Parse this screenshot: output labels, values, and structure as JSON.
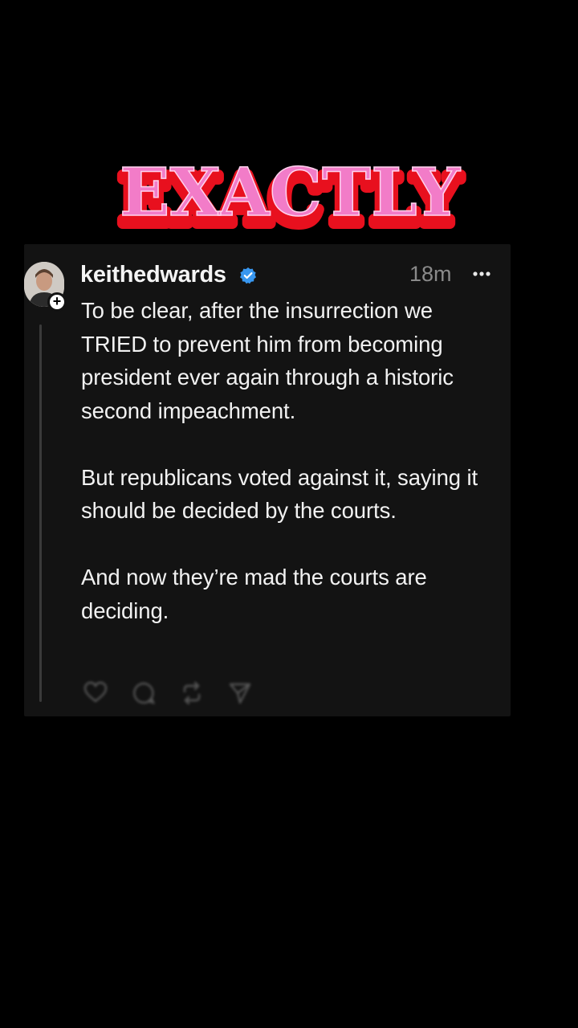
{
  "overlay": {
    "sticker_text": "EXACTLY"
  },
  "post": {
    "username": "keithedwards",
    "timestamp": "18m",
    "paragraphs": [
      "To be clear, after the insurrection we TRIED to prevent him from becoming president ever again through a historic second impeachment.",
      "But republicans voted against it, saying it should be decided by the courts.",
      "And now they’re mad the courts are deciding."
    ],
    "icons": {
      "verified": "verified-badge-icon",
      "more": "more-options-icon",
      "follow": "follow-plus-icon",
      "like": "heart-icon",
      "reply": "comment-icon",
      "repost": "repost-icon",
      "share": "send-icon"
    }
  },
  "colors": {
    "background": "#000000",
    "card": "#131313",
    "text": "#f2f2f2",
    "muted": "#8a8a8a",
    "verified": "#3897f0",
    "sticker_fill": "#f27cc8",
    "sticker_shadow": "#e8101e"
  }
}
